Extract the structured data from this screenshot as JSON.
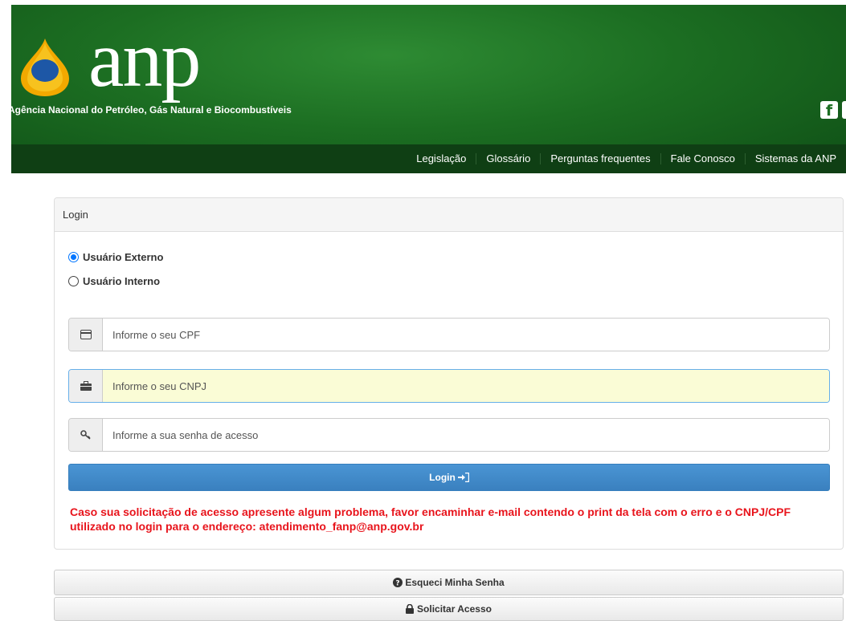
{
  "header": {
    "logo_text": "anp",
    "agency_name": "Agência Nacional do Petróleo, Gás Natural e Biocombustíveis",
    "social_icon": "facebook-icon",
    "nav": [
      "Legislação",
      "Glossário",
      "Perguntas frequentes",
      "Fale Conosco",
      "Sistemas da ANP"
    ]
  },
  "login": {
    "title": "Login",
    "radio_external": "Usuário Externo",
    "radio_internal": "Usuário Interno",
    "selected": "external",
    "cpf_placeholder": "Informe o seu CPF",
    "cnpj_placeholder": "Informe o seu CNPJ",
    "password_placeholder": "Informe a sua senha de acesso",
    "button_label": "Login",
    "warning": "Caso sua solicitação de acesso apresente algum problema, favor encaminhar e-mail contendo o print da tela com o erro e o CNPJ/CPF utilizado no login para o endereço: atendimento_fanp@anp.gov.br"
  },
  "bottom": {
    "forgot_password": "Esqueci Minha Senha",
    "request_access": "Solicitar Acesso"
  },
  "colors": {
    "header_green": "#1c6e22",
    "nav_dark": "#0f3f14",
    "primary_blue": "#428bca",
    "warning_red": "#e8141c"
  }
}
